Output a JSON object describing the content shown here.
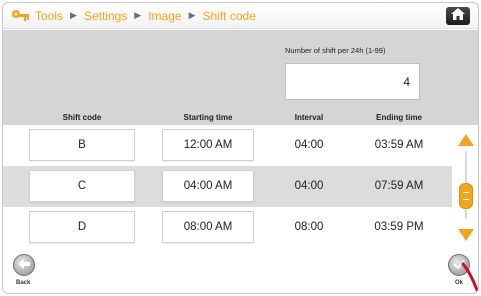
{
  "breadcrumb": {
    "items": [
      "Tools",
      "Settings",
      "Image",
      "Shift code"
    ]
  },
  "shift_count": {
    "label": "Number of shift per 24h (1-99)",
    "value": "4"
  },
  "table": {
    "headers": {
      "shift_code": "Shift code",
      "starting_time": "Starting time",
      "interval": "Interval",
      "ending_time": "Ending time"
    },
    "rows": [
      {
        "shift_code": "B",
        "starting_time": "12:00 AM",
        "interval": "04:00",
        "ending_time": "03:59 AM"
      },
      {
        "shift_code": "C",
        "starting_time": "04:00 AM",
        "interval": "04:00",
        "ending_time": "07:59 AM"
      },
      {
        "shift_code": "D",
        "starting_time": "08:00 AM",
        "interval": "08:00",
        "ending_time": "03:59 PM"
      }
    ]
  },
  "footer": {
    "back_label": "Back",
    "ok_label": "Ok"
  },
  "icons": {
    "breadcrumb": "key-icon",
    "home": "home-icon",
    "scroll_up": "arrow-up-icon",
    "scroll_down": "arrow-down-icon",
    "back": "back-arrow-icon",
    "ok": "check-icon"
  },
  "colors": {
    "accent": "#f7a21b",
    "panel": "#d5d5d5"
  }
}
